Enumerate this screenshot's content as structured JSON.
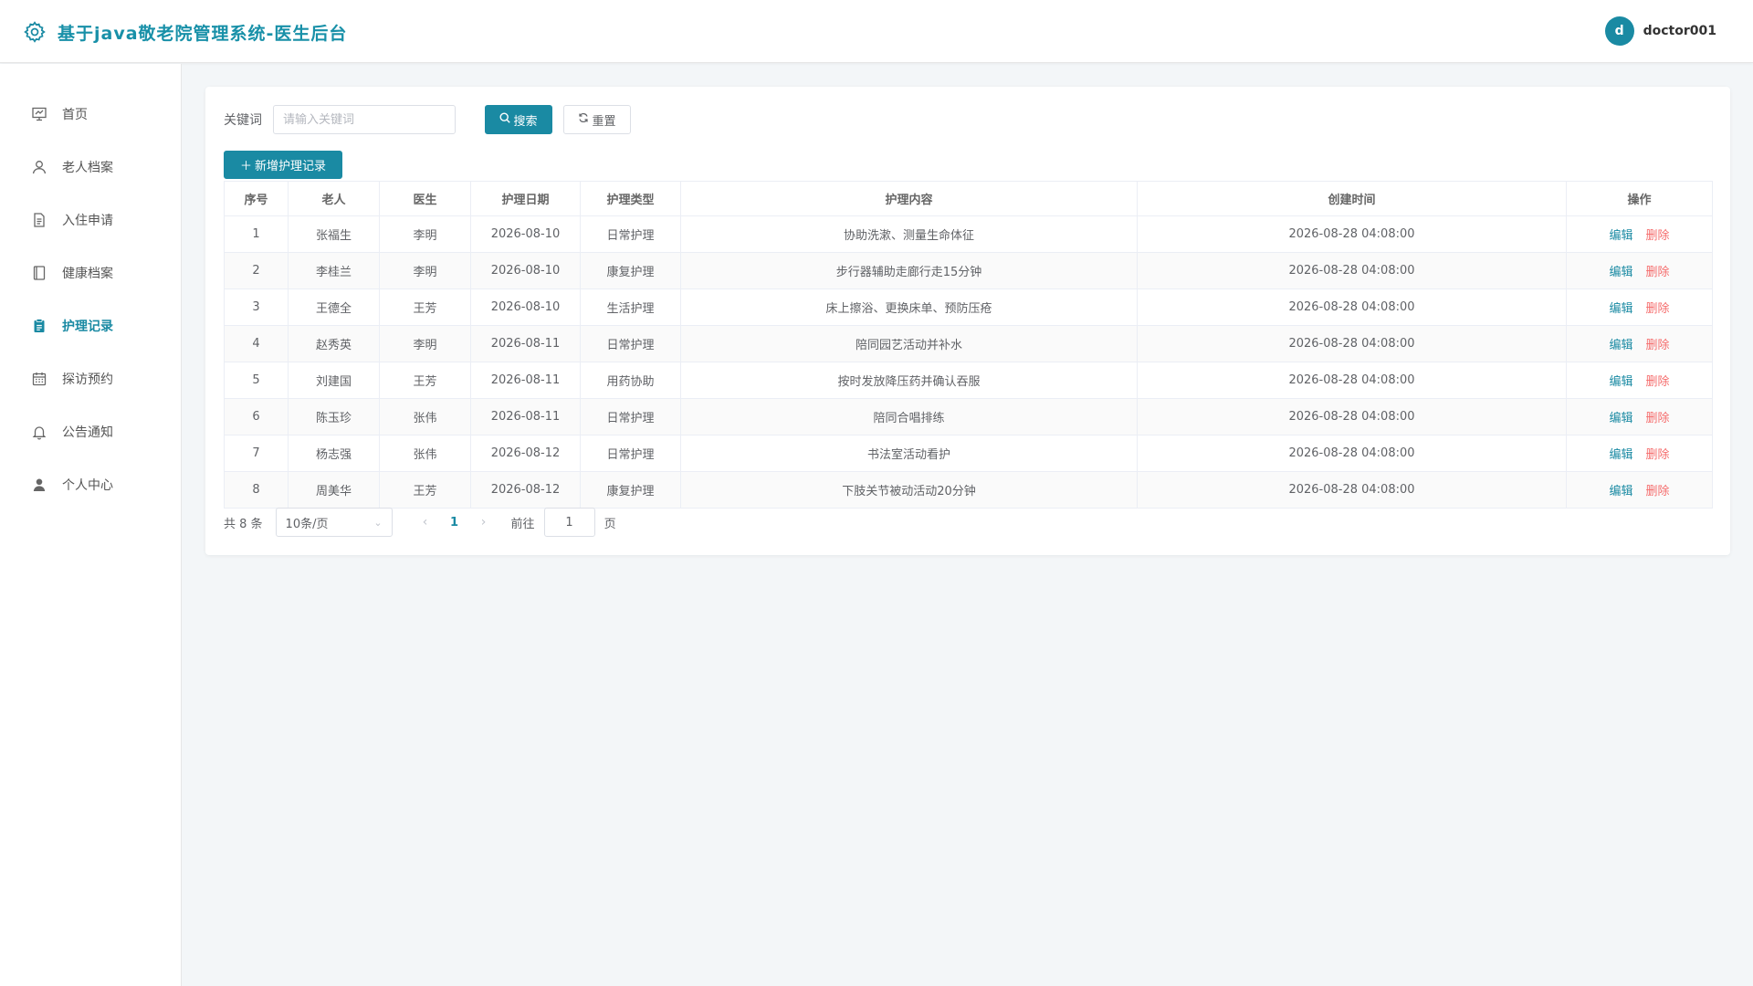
{
  "app": {
    "title": "基于java敬老院管理系统-医生后台",
    "icon": "gear-icon",
    "accent_color": "#1a8aa3",
    "danger_color": "#f56c6c"
  },
  "user": {
    "avatar_letter": "d",
    "username": "doctor001"
  },
  "sidebar": {
    "items": [
      {
        "label": "首页",
        "icon": "chart-board-icon",
        "active": false
      },
      {
        "label": "老人档案",
        "icon": "person-icon",
        "active": false
      },
      {
        "label": "入住申请",
        "icon": "document-icon",
        "active": false
      },
      {
        "label": "健康档案",
        "icon": "notebook-icon",
        "active": false
      },
      {
        "label": "护理记录",
        "icon": "clipboard-icon",
        "active": true
      },
      {
        "label": "探访预约",
        "icon": "calendar-icon",
        "active": false
      },
      {
        "label": "公告通知",
        "icon": "bell-icon",
        "active": false
      },
      {
        "label": "个人中心",
        "icon": "user-icon",
        "active": false
      }
    ]
  },
  "search": {
    "label": "关键词",
    "placeholder": "请输入关键词",
    "value": "",
    "search_button": "搜索",
    "reset_button": "重置"
  },
  "toolbar": {
    "add_button": "新增护理记录"
  },
  "table": {
    "columns": [
      "序号",
      "老人",
      "医生",
      "护理日期",
      "护理类型",
      "护理内容",
      "创建时间",
      "操作"
    ],
    "edit_label": "编辑",
    "delete_label": "删除",
    "rows": [
      {
        "no": "1",
        "elder": "张福生",
        "doctor": "李明",
        "date": "2026-08-10",
        "type": "日常护理",
        "content": "协助洗漱、测量生命体征",
        "created": "2026-08-28 04:08:00"
      },
      {
        "no": "2",
        "elder": "李桂兰",
        "doctor": "李明",
        "date": "2026-08-10",
        "type": "康复护理",
        "content": "步行器辅助走廊行走15分钟",
        "created": "2026-08-28 04:08:00"
      },
      {
        "no": "3",
        "elder": "王德全",
        "doctor": "王芳",
        "date": "2026-08-10",
        "type": "生活护理",
        "content": "床上擦浴、更换床单、预防压疮",
        "created": "2026-08-28 04:08:00"
      },
      {
        "no": "4",
        "elder": "赵秀英",
        "doctor": "李明",
        "date": "2026-08-11",
        "type": "日常护理",
        "content": "陪同园艺活动并补水",
        "created": "2026-08-28 04:08:00"
      },
      {
        "no": "5",
        "elder": "刘建国",
        "doctor": "王芳",
        "date": "2026-08-11",
        "type": "用药协助",
        "content": "按时发放降压药并确认吞服",
        "created": "2026-08-28 04:08:00"
      },
      {
        "no": "6",
        "elder": "陈玉珍",
        "doctor": "张伟",
        "date": "2026-08-11",
        "type": "日常护理",
        "content": "陪同合唱排练",
        "created": "2026-08-28 04:08:00"
      },
      {
        "no": "7",
        "elder": "杨志强",
        "doctor": "张伟",
        "date": "2026-08-12",
        "type": "日常护理",
        "content": "书法室活动看护",
        "created": "2026-08-28 04:08:00"
      },
      {
        "no": "8",
        "elder": "周美华",
        "doctor": "王芳",
        "date": "2026-08-12",
        "type": "康复护理",
        "content": "下肢关节被动活动20分钟",
        "created": "2026-08-28 04:08:00"
      }
    ]
  },
  "pagination": {
    "total_text": "共 8 条",
    "page_size": "10条/页",
    "current_page": "1",
    "goto_label": "前往",
    "goto_value": "1",
    "goto_suffix": "页"
  }
}
